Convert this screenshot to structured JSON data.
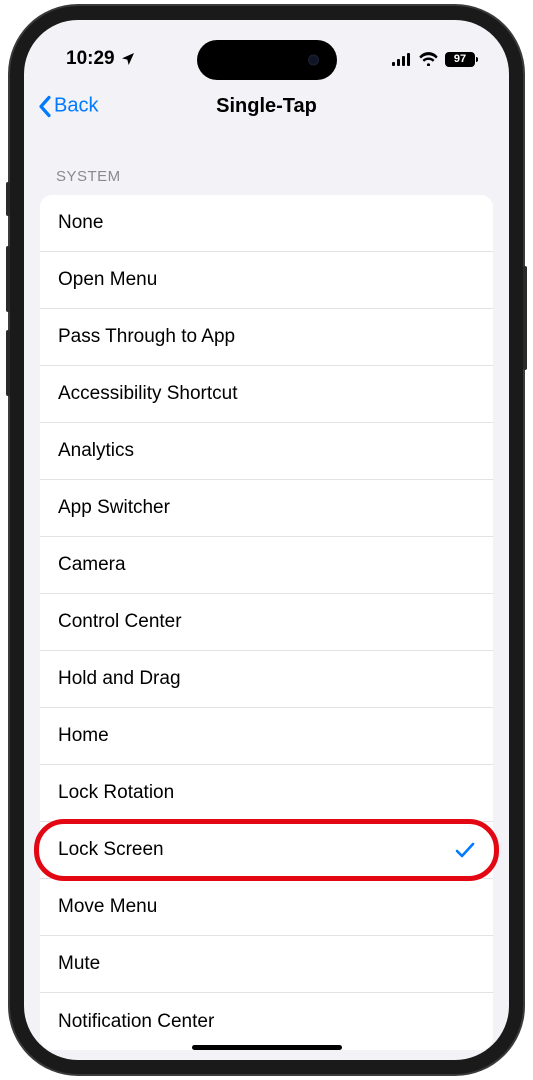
{
  "status": {
    "time": "10:29",
    "battery": "97"
  },
  "nav": {
    "back": "Back",
    "title": "Single-Tap"
  },
  "section": {
    "header": "SYSTEM"
  },
  "items": [
    {
      "label": "None",
      "selected": false,
      "highlighted": false
    },
    {
      "label": "Open Menu",
      "selected": false,
      "highlighted": false
    },
    {
      "label": "Pass Through to App",
      "selected": false,
      "highlighted": false
    },
    {
      "label": "Accessibility Shortcut",
      "selected": false,
      "highlighted": false
    },
    {
      "label": "Analytics",
      "selected": false,
      "highlighted": false
    },
    {
      "label": "App Switcher",
      "selected": false,
      "highlighted": false
    },
    {
      "label": "Camera",
      "selected": false,
      "highlighted": false
    },
    {
      "label": "Control Center",
      "selected": false,
      "highlighted": false
    },
    {
      "label": "Hold and Drag",
      "selected": false,
      "highlighted": false
    },
    {
      "label": "Home",
      "selected": false,
      "highlighted": false
    },
    {
      "label": "Lock Rotation",
      "selected": false,
      "highlighted": false
    },
    {
      "label": "Lock Screen",
      "selected": true,
      "highlighted": true
    },
    {
      "label": "Move Menu",
      "selected": false,
      "highlighted": false
    },
    {
      "label": "Mute",
      "selected": false,
      "highlighted": false
    },
    {
      "label": "Notification Center",
      "selected": false,
      "highlighted": false
    }
  ]
}
